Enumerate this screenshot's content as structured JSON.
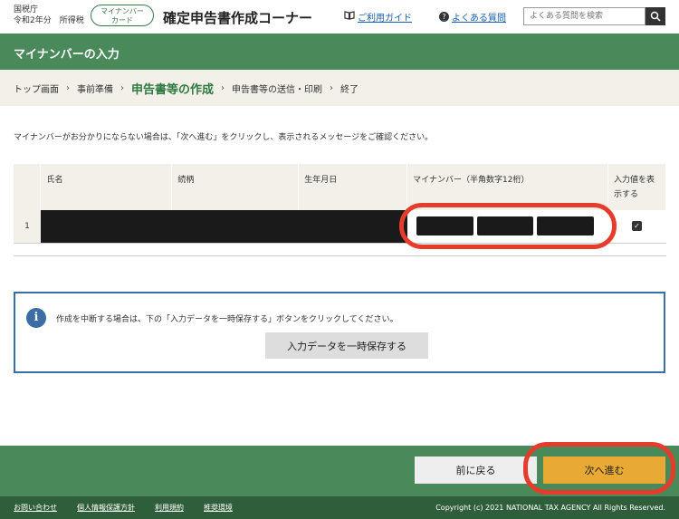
{
  "header": {
    "agency_line1": "国税庁",
    "agency_line2": "令和2年分　所得税",
    "mynumber_card_line1": "マイナンバー",
    "mynumber_card_line2": "カード",
    "title": "確定申告書作成コーナー",
    "guide_label": "ご利用ガイド",
    "faq_label": "よくある質問",
    "search_placeholder": "よくある質問を検索"
  },
  "page_title": "マイナンバーの入力",
  "breadcrumb": {
    "steps": [
      "トップ画面",
      "事前準備",
      "申告書等の作成",
      "申告書等の送信・印刷",
      "終了"
    ]
  },
  "notice": "マイナンバーがお分かりにならない場合は、「次へ進む」をクリックし、表示されるメッセージをご確認ください。",
  "table": {
    "headers": [
      "氏名",
      "続柄",
      "生年月日",
      "マイナンバー（半角数字12桁）",
      "入力値を表示する"
    ],
    "rows": [
      {
        "index": "1",
        "show_value_checked": "✓"
      }
    ]
  },
  "info": {
    "icon": "i",
    "text": "作成を中断する場合は、下の「入力データを一時保存する」ボタンをクリックしてください。",
    "save_button": "入力データを一時保存する"
  },
  "actions": {
    "back": "前に戻る",
    "next": "次へ進む"
  },
  "footer": {
    "links": [
      "お問い合わせ",
      "個人情報保護方針",
      "利用規約",
      "推奨環境"
    ],
    "copyright": "Copyright (c) 2021 NATIONAL TAX AGENCY All Rights Reserved."
  },
  "colors": {
    "brand_green": "#4a8a5a",
    "footer_green": "#2f5f3a",
    "accent_orange": "#e8a935",
    "highlight_red": "#e53c2c",
    "info_blue": "#3a6ea5"
  },
  "icons": {
    "guide": "book-icon",
    "faq": "question-icon",
    "search": "search-icon",
    "info": "info-icon",
    "checkbox": "checkbox-checked-icon"
  }
}
